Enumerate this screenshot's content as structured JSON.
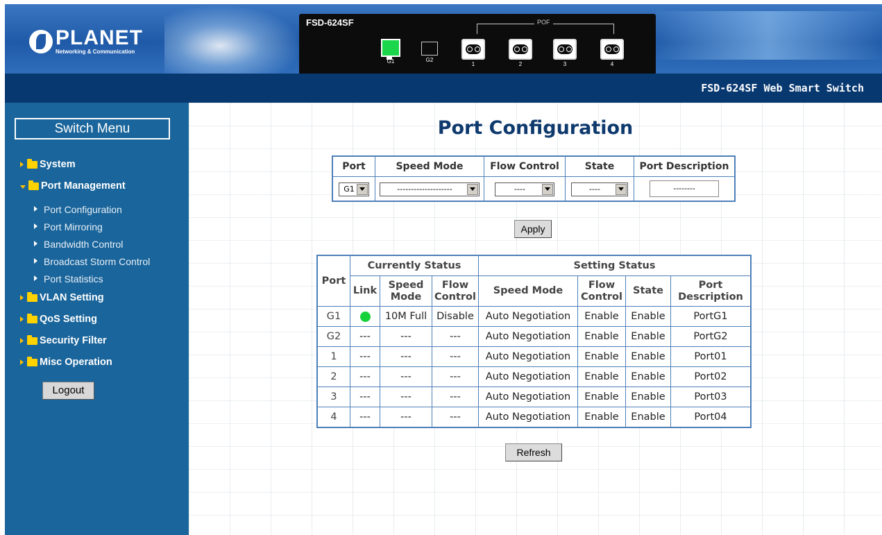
{
  "header": {
    "brand": "PLANET",
    "brand_sub": "Networking & Communication",
    "device_model": "FSD-624SF",
    "pof_label": "POF",
    "ports": [
      "G1",
      "G2",
      "1",
      "2",
      "3",
      "4"
    ],
    "title": "FSD-624SF Web Smart Switch"
  },
  "sidebar": {
    "heading": "Switch Menu",
    "menus": [
      {
        "label": "System",
        "open": false
      },
      {
        "label": "Port Management",
        "open": true
      },
      {
        "label": "VLAN Setting",
        "open": false
      },
      {
        "label": "QoS Setting",
        "open": false
      },
      {
        "label": "Security Filter",
        "open": false
      },
      {
        "label": "Misc Operation",
        "open": false
      }
    ],
    "submenu": [
      "Port Configuration",
      "Port Mirroring",
      "Bandwidth Control",
      "Broadcast Storm Control",
      "Port Statistics"
    ],
    "logout_label": "Logout"
  },
  "main": {
    "page_title": "Port Configuration",
    "config": {
      "headers": [
        "Port",
        "Speed Mode",
        "Flow Control",
        "State",
        "Port Description"
      ],
      "port_value": "G1",
      "speed_value": "--------------------",
      "flow_value": "----",
      "state_value": "----",
      "desc_value": "--------"
    },
    "apply_label": "Apply",
    "status": {
      "group_current": "Currently Status",
      "group_setting": "Setting Status",
      "col_port": "Port",
      "col_link": "Link",
      "col_speed": "Speed Mode",
      "col_flow": "Flow Control",
      "col_set_speed": "Speed Mode",
      "col_set_flow": "Flow Control",
      "col_state": "State",
      "col_desc": "Port Description",
      "rows": [
        {
          "port": "G1",
          "link": "up",
          "speed": "10M Full",
          "flow": "Disable",
          "set_speed": "Auto Negotiation",
          "set_flow": "Enable",
          "state": "Enable",
          "desc": "PortG1"
        },
        {
          "port": "G2",
          "link": "---",
          "speed": "---",
          "flow": "---",
          "set_speed": "Auto Negotiation",
          "set_flow": "Enable",
          "state": "Enable",
          "desc": "PortG2"
        },
        {
          "port": "1",
          "link": "---",
          "speed": "---",
          "flow": "---",
          "set_speed": "Auto Negotiation",
          "set_flow": "Enable",
          "state": "Enable",
          "desc": "Port01"
        },
        {
          "port": "2",
          "link": "---",
          "speed": "---",
          "flow": "---",
          "set_speed": "Auto Negotiation",
          "set_flow": "Enable",
          "state": "Enable",
          "desc": "Port02"
        },
        {
          "port": "3",
          "link": "---",
          "speed": "---",
          "flow": "---",
          "set_speed": "Auto Negotiation",
          "set_flow": "Enable",
          "state": "Enable",
          "desc": "Port03"
        },
        {
          "port": "4",
          "link": "---",
          "speed": "---",
          "flow": "---",
          "set_speed": "Auto Negotiation",
          "set_flow": "Enable",
          "state": "Enable",
          "desc": "Port04"
        }
      ]
    },
    "refresh_label": "Refresh"
  },
  "colors": {
    "banner": "#1f5aa8",
    "titlebar": "#083870",
    "sidebar": "#1a659b",
    "table_border": "#4d7fb8",
    "link_up": "#17d13a",
    "folder": "#ffd200"
  }
}
